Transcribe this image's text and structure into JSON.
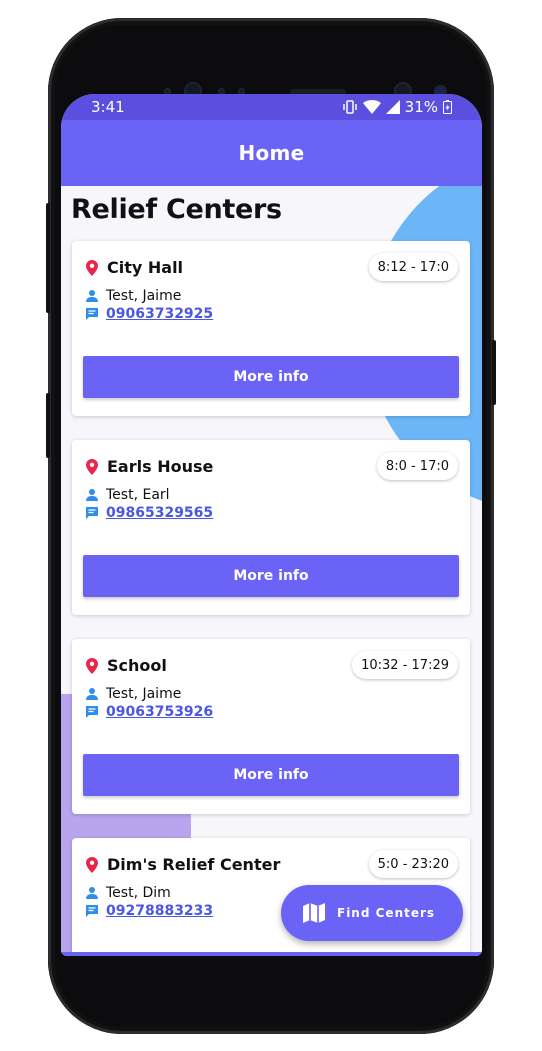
{
  "status_bar": {
    "time": "3:41",
    "battery": "31%"
  },
  "app_bar": {
    "title": "Home"
  },
  "page": {
    "title": "Relief Centers"
  },
  "cards": [
    {
      "name": "City Hall",
      "hours": "8:12 - 17:0",
      "contact": "Test, Jaime",
      "phone": "09063732925",
      "button": "More info"
    },
    {
      "name": "Earls House",
      "hours": "8:0 - 17:0",
      "contact": "Test, Earl",
      "phone": "09865329565",
      "button": "More info"
    },
    {
      "name": "School",
      "hours": "10:32 - 17:29",
      "contact": "Test, Jaime",
      "phone": "09063753926",
      "button": "More info"
    },
    {
      "name": "Dim's Relief Center",
      "hours": "5:0 - 23:20",
      "contact": "Test, Dim",
      "phone": "09278883233"
    }
  ],
  "fab": {
    "label": "Find Centers",
    "icon": "map-icon"
  },
  "colors": {
    "primary": "#6b63f6",
    "status_bar": "#5b4fe0",
    "pin": "#e8264a",
    "link": "#4a57e0",
    "accent_blue": "#6cb6f8",
    "accent_purple": "#b9a4ee"
  }
}
